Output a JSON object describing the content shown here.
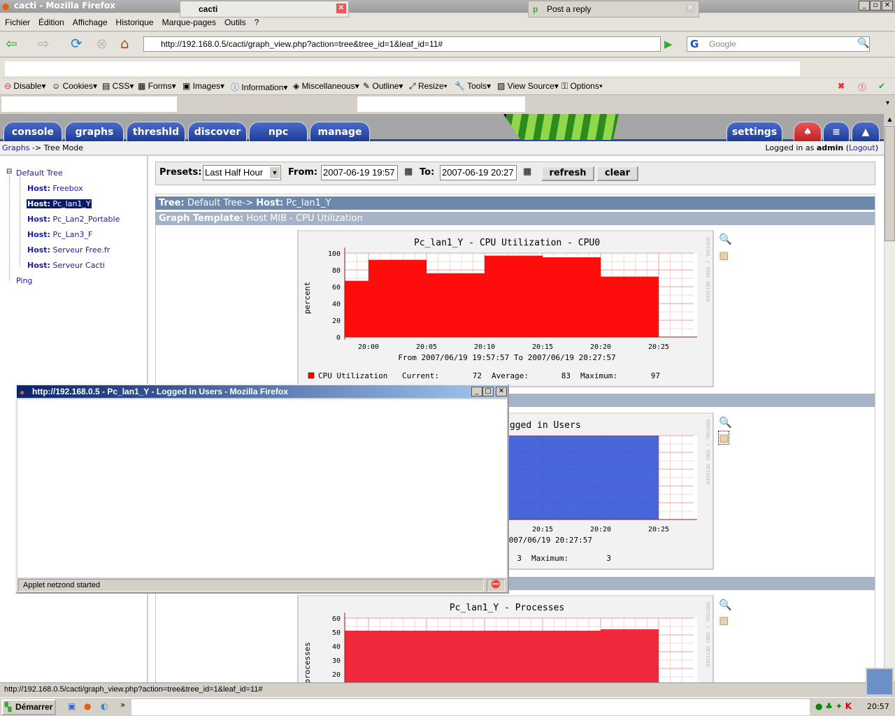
{
  "window": {
    "title": "cacti - Mozilla Firefox"
  },
  "menu": [
    "Fichier",
    "Édition",
    "Affichage",
    "Historique",
    "Marque-pages",
    "Outils",
    "?"
  ],
  "nav": {
    "url": "http://192.168.0.5/cacti/graph_view.php?action=tree&tree_id=1&leaf_id=11#",
    "search_placeholder": "Google"
  },
  "devbar": [
    "Disable",
    "Cookies",
    "CSS",
    "Forms",
    "Images",
    "Information",
    "Miscellaneous",
    "Outline",
    "Resize",
    "Tools",
    "View Source",
    "Options"
  ],
  "tabs": [
    {
      "label": "cacti"
    },
    {
      "label": "Post a reply"
    }
  ],
  "cacti": {
    "tabs": [
      "console",
      "graphs",
      "threshld",
      "discover",
      "npc",
      "manage"
    ],
    "settings": "settings",
    "breadcrumb_link": "Graphs",
    "breadcrumb_rest": " -> Tree Mode",
    "logged_prefix": "Logged in as ",
    "user": "admin",
    "logout": "Logout"
  },
  "tree": {
    "root": "Default Tree",
    "hosts": [
      {
        "prefix": "Host:",
        "name": "Freebox"
      },
      {
        "prefix": "Host:",
        "name": "Pc_lan1_Y",
        "selected": true
      },
      {
        "prefix": "Host:",
        "name": "Pc_Lan2_Portable"
      },
      {
        "prefix": "Host:",
        "name": "Pc_Lan3_F"
      },
      {
        "prefix": "Host:",
        "name": "Serveur Free.fr"
      },
      {
        "prefix": "Host:",
        "name": "Serveur Cacti"
      }
    ],
    "other": "Ping"
  },
  "filter": {
    "presets_label": "Presets:",
    "preset": "Last Half Hour",
    "from_label": "From:",
    "from": "2007-06-19 19:57",
    "to_label": "To:",
    "to": "2007-06-19 20:27",
    "refresh": "refresh",
    "clear": "clear"
  },
  "headers": {
    "tree_label": "Tree:",
    "tree_value": " Default Tree-> ",
    "host_label": "Host:",
    "host_value": " Pc_lan1_Y",
    "template_label": "Graph Template:",
    "template_value": " Host MIB - CPU Utilization"
  },
  "chart_data": [
    {
      "type": "area",
      "title": "Pc_lan1_Y - CPU Utilization - CPU0",
      "ylabel": "percent",
      "ylim": [
        0,
        100
      ],
      "yticks": [
        0,
        20,
        40,
        60,
        80,
        100
      ],
      "xticks": [
        "20:00",
        "20:05",
        "20:10",
        "20:15",
        "20:20",
        "20:25"
      ],
      "range": "From 2007/06/19 19:57:57 To 2007/06/19 20:27:57",
      "color": "#ff0000",
      "steps": [
        {
          "from": "19:57:57",
          "to": "20:00",
          "value": 67
        },
        {
          "from": "20:00",
          "to": "20:05",
          "value": 92
        },
        {
          "from": "20:05",
          "to": "20:10",
          "value": 76
        },
        {
          "from": "20:10",
          "to": "20:15",
          "value": 97
        },
        {
          "from": "20:15",
          "to": "20:20",
          "value": 95
        },
        {
          "from": "20:20",
          "to": "20:25",
          "value": 72
        }
      ],
      "legend": {
        "name": "CPU Utilization",
        "current_label": "Current:",
        "current": "72",
        "average_label": "Average:",
        "average": "83",
        "maximum_label": "Maximum:",
        "maximum": "97"
      }
    },
    {
      "type": "area",
      "title": "Pc_lan1_Y - Logged in Users",
      "ylabel": "",
      "ylim": [
        0,
        3
      ],
      "yticks": [],
      "xticks": [
        "20:15",
        "20:20",
        "20:25"
      ],
      "range": "To 2007/06/19 20:27:57",
      "color": "#3d5fd9",
      "steps": [
        {
          "from": "19:57:57",
          "to": "20:25",
          "value": 3
        }
      ],
      "legend": {
        "name": "",
        "average": "3",
        "maximum_label": "Maximum:",
        "maximum": "3"
      }
    },
    {
      "type": "area",
      "title": "Pc_lan1_Y - Processes",
      "ylabel": "processes",
      "ylim": [
        0,
        60
      ],
      "yticks": [
        20,
        30,
        40,
        50,
        60
      ],
      "xticks": [],
      "range": "",
      "color": "#f01e32",
      "steps": [
        {
          "from": "19:57:57",
          "to": "20:20",
          "value": 51
        },
        {
          "from": "20:20",
          "to": "20:25",
          "value": 52
        }
      ],
      "legend": null
    }
  ],
  "watermark": "RRDTOOL / TOBI OETIKER",
  "popup": {
    "title": "http://192.168.0.5 - Pc_lan1_Y - Logged in Users - Mozilla Firefox",
    "status": "Applet netzond started"
  },
  "statusbar": "http://192.168.0.5/cacti/graph_view.php?action=tree&tree_id=1&leaf_id=11#",
  "taskbar": {
    "start": "Démarrer",
    "clock": "20:57"
  }
}
